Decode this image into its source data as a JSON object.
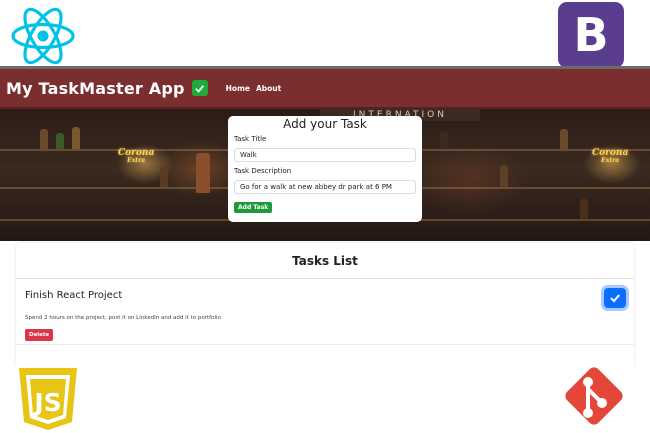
{
  "navbar": {
    "brand": "My TaskMaster App",
    "links": [
      "Home",
      "About"
    ]
  },
  "hero": {
    "sign_text": "INTERNATION",
    "corona_text": "Corona",
    "corona_sub": "Extra"
  },
  "form": {
    "title": "Add your Task",
    "title_label": "Task Title",
    "title_value": "Walk",
    "description_label": "Task Description",
    "description_value": "Go for a walk at new abbey dr park at 6 PM",
    "submit_label": "Add Task"
  },
  "tasks": {
    "heading": "Tasks List",
    "items": [
      {
        "title": "Finish React Project",
        "description": "Spend 2 hours on the project, post it on LinkedIn and add it to portfolio",
        "delete_label": "Delete",
        "completed": true
      }
    ]
  },
  "logos": {
    "bootstrap_letter": "B",
    "js_letters": "JS"
  },
  "colors": {
    "navbar": "#7a2e30",
    "add_button": "#1e9a3c",
    "delete_button": "#dc3545",
    "checkbox": "#0d6efd",
    "bootstrap": "#5a3d8f",
    "react": "#00c4e6",
    "js": "#e8c514",
    "git": "#e4473a"
  }
}
